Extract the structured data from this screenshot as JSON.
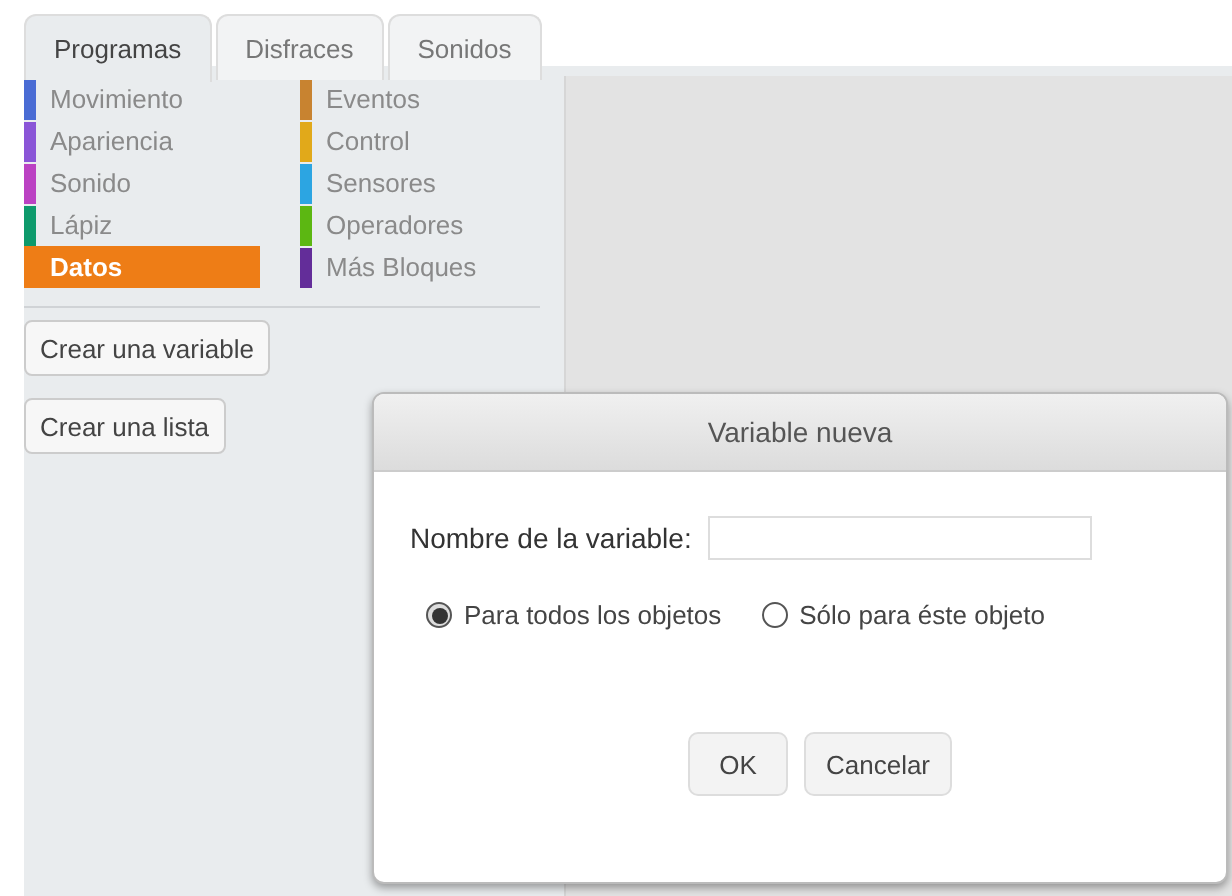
{
  "tabs": [
    {
      "label": "Programas",
      "selected": true
    },
    {
      "label": "Disfraces",
      "selected": false
    },
    {
      "label": "Sonidos",
      "selected": false
    }
  ],
  "categories": [
    {
      "label": "Movimiento",
      "color": "#4a6cd4",
      "selected": false
    },
    {
      "label": "Apariencia",
      "color": "#8a55d7",
      "selected": false
    },
    {
      "label": "Sonido",
      "color": "#bb42c3",
      "selected": false
    },
    {
      "label": "Lápiz",
      "color": "#0e9a6c",
      "selected": false
    },
    {
      "label": "Datos",
      "color": "#ee7d16",
      "selected": true
    },
    {
      "label": "Eventos",
      "color": "#c88330",
      "selected": false
    },
    {
      "label": "Control",
      "color": "#e1a91a",
      "selected": false
    },
    {
      "label": "Sensores",
      "color": "#2ca5e2",
      "selected": false
    },
    {
      "label": "Operadores",
      "color": "#5cb712",
      "selected": false
    },
    {
      "label": "Más Bloques",
      "color": "#632d99",
      "selected": false
    }
  ],
  "palette_buttons": [
    "Crear una variable",
    "Crear una lista"
  ],
  "dialog": {
    "title": "Variable nueva",
    "field_label": "Nombre de la variable:",
    "options": [
      {
        "label": "Para todos los objetos",
        "selected": true
      },
      {
        "label": "Sólo para éste objeto",
        "selected": false
      }
    ],
    "buttons": [
      "OK",
      "Cancelar"
    ]
  }
}
